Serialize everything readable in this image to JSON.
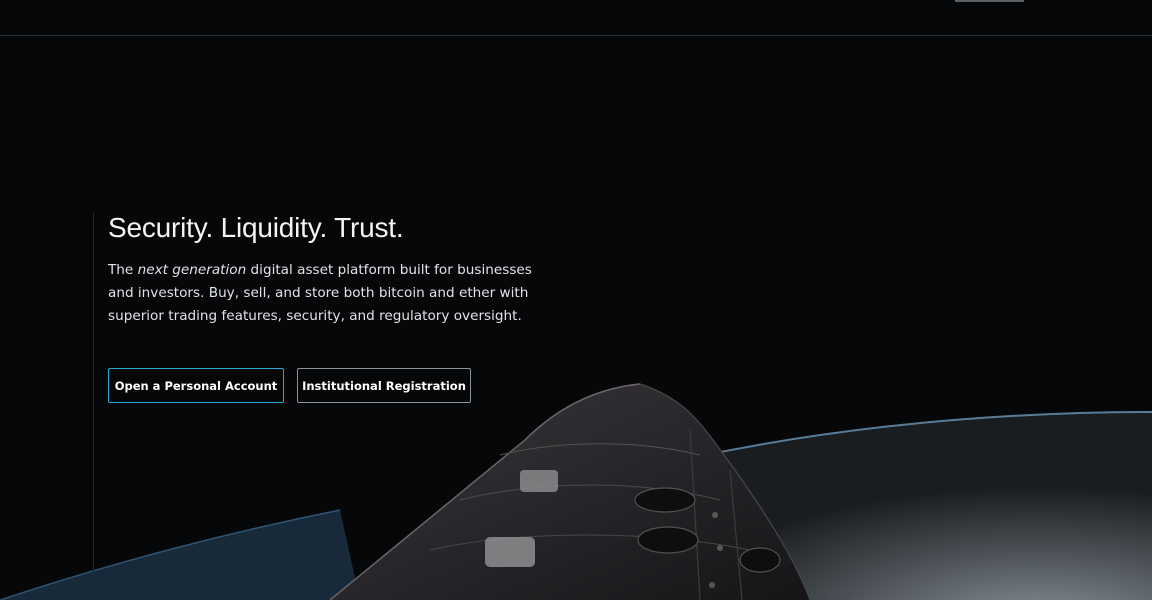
{
  "hero": {
    "title": "Security. Liquidity. Trust.",
    "description": {
      "part1": "The ",
      "emphasis": "next generation",
      "part2": " digital asset platform built for businesses and investors. Buy, sell, and store both bitcoin and ether with superior trading features, security, and regulatory oversight."
    },
    "buttons": {
      "personal_label": "Open a Personal Account",
      "institutional_label": "Institutional Registration"
    },
    "background_image": "spacecraft-over-earth"
  },
  "colors": {
    "background": "#060708",
    "primary_accent": "#2aa9d8",
    "text": "#f3f4f5",
    "secondary_border": "#8d9196"
  }
}
